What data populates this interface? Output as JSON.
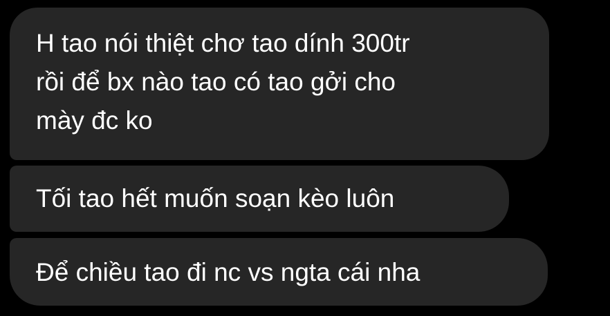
{
  "messages": [
    {
      "lines": [
        "H tao nói thiệt chơ tao dính 300tr",
        "rồi để bx nào tao có tao gởi cho",
        "mày đc ko"
      ]
    },
    {
      "lines": [
        "Tối tao hết muốn soạn kèo luôn"
      ]
    },
    {
      "lines": [
        "Để chiều tao đi nc vs ngta cái nha"
      ]
    }
  ],
  "colors": {
    "background": "#000000",
    "bubble": "#262626",
    "text": "#ffffff"
  }
}
